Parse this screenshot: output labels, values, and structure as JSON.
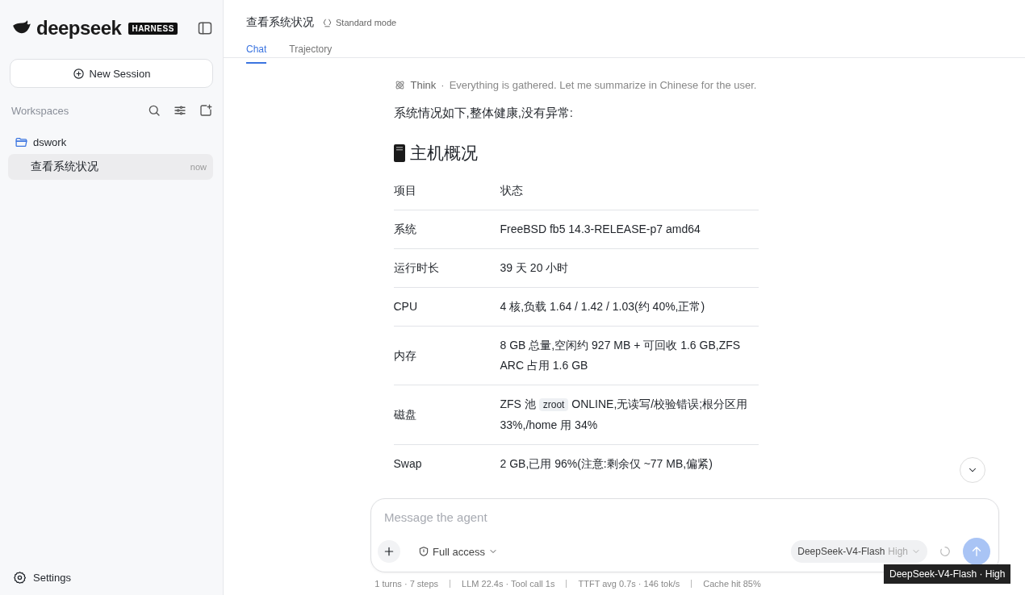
{
  "sidebar": {
    "logo": "deepseek",
    "badge": "HARNESS",
    "new_session": "New Session",
    "workspaces_label": "Workspaces",
    "workspaces": [
      {
        "name": "dswork",
        "expanded": true,
        "sessions": [
          {
            "title": "查看系统状况",
            "time": "now",
            "selected": true
          }
        ]
      }
    ],
    "settings": "Settings"
  },
  "header": {
    "title": "查看系统状况",
    "mode": "Standard mode",
    "tabs": [
      {
        "label": "Chat",
        "selected": true
      },
      {
        "label": "Trajectory",
        "selected": false
      }
    ]
  },
  "chat": {
    "think": {
      "label": "Think",
      "separator": "·",
      "text": "Everything is gathered. Let me summarize in Chinese for the user."
    },
    "intro": "系统情况如下,整体健康,没有异常:",
    "heading": "主机概况",
    "table": {
      "columns": [
        "项目",
        "状态"
      ],
      "rows": [
        [
          "系统",
          "FreeBSD fb5 14.3-RELEASE-p7 amd64"
        ],
        [
          "运行时长",
          "39 天 20 小时"
        ],
        [
          "CPU",
          "4 核,负载 1.64 / 1.42 / 1.03(约 40%,正常)"
        ],
        [
          "内存",
          "8 GB 总量,空闲约 927 MB + 可回收 1.6 GB,ZFS ARC 占用 1.6 GB"
        ],
        [
          "磁盘",
          [
            {
              "kind": "text",
              "text": "ZFS 池 "
            },
            {
              "kind": "code",
              "text": "zroot"
            },
            {
              "kind": "text",
              "text": " ONLINE,无读写/校验错误;根分区用 33%,/home 用 34%"
            }
          ]
        ],
        [
          "Swap",
          "2 GB,已用 96%(注意:剩余仅 ~77 MB,偏紧)"
        ]
      ]
    }
  },
  "composer": {
    "placeholder": "Message the agent",
    "access": "Full access",
    "model": "DeepSeek-V4-Flash",
    "effort": "High",
    "tooltip": "DeepSeek-V4-Flash · High"
  },
  "status_bar": [
    "1 turns · 7 steps",
    "LLM 22.4s · Tool call 1s",
    "TTFT avg 0.7s · 146 tok/s",
    "Cache hit 85%"
  ]
}
